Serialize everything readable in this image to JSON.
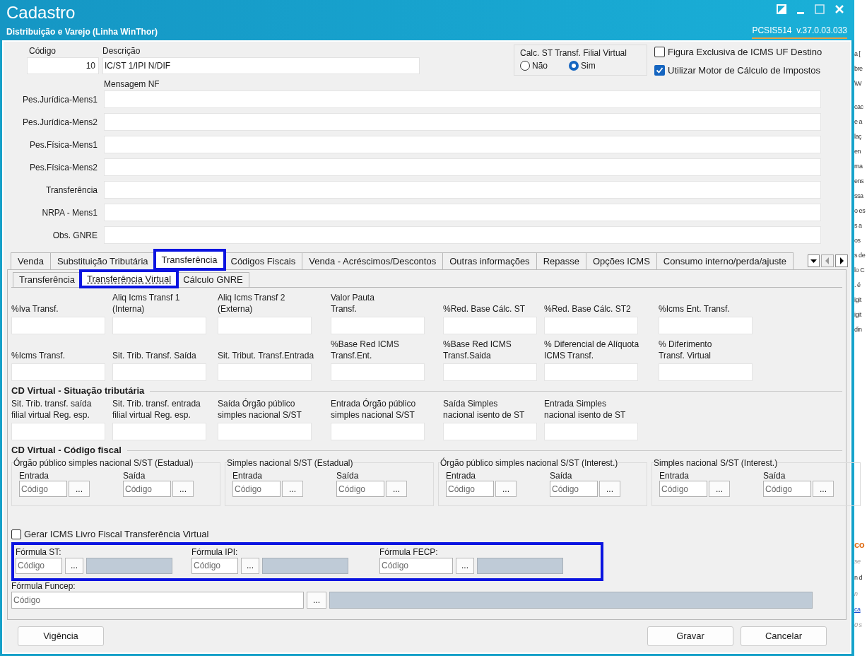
{
  "window": {
    "title": "Cadastro",
    "subtitle": "Distribuição e Varejo (Linha WinThor)",
    "version": "PCSIS514  v.37.0.03.033"
  },
  "header": {
    "codigo": {
      "label": "Código",
      "value": "10"
    },
    "descricao": {
      "label": "Descrição",
      "value": "IC/ST 1/IPI N/DIF"
    },
    "calc_st": {
      "label": "Calc. ST Transf. Filial Virtual",
      "options": [
        {
          "label": "Não",
          "selected": false
        },
        {
          "label": "Sim",
          "selected": true
        }
      ]
    },
    "checkboxes": [
      {
        "label": "Figura Exclusiva de ICMS UF Destino",
        "checked": false
      },
      {
        "label": "Utilizar Motor de Cálculo de Impostos",
        "checked": true
      }
    ]
  },
  "mensagem": {
    "title": "Mensagem NF",
    "fields": [
      {
        "label": "Pes.Jurídica-Mens1"
      },
      {
        "label": "Pes.Jurídica-Mens2"
      },
      {
        "label": "Pes.Física-Mens1"
      },
      {
        "label": "Pes.Física-Mens2"
      },
      {
        "label": "Transferência"
      },
      {
        "label": "NRPA - Mens1"
      },
      {
        "label": "Obs. GNRE"
      }
    ]
  },
  "tabs": [
    {
      "label": "Venda",
      "selected": false,
      "highlighted": false
    },
    {
      "label": "Substituição Tributária",
      "selected": false,
      "highlighted": false
    },
    {
      "label": "Transferência",
      "selected": true,
      "highlighted": true
    },
    {
      "label": "Códigos Fiscais",
      "selected": false,
      "highlighted": false
    },
    {
      "label": "Venda - Acréscimos/Descontos",
      "selected": false,
      "highlighted": false
    },
    {
      "label": "Outras informações",
      "selected": false,
      "highlighted": false
    },
    {
      "label": "Repasse",
      "selected": false,
      "highlighted": false
    },
    {
      "label": "Opções ICMS",
      "selected": false,
      "highlighted": false
    },
    {
      "label": "Consumo interno/perda/ajuste",
      "selected": false,
      "highlighted": false
    }
  ],
  "subtabs": [
    {
      "label": "Transferência",
      "selected": false,
      "highlighted": false
    },
    {
      "label": "Transferência Virtual",
      "selected": true,
      "highlighted": true
    },
    {
      "label": "Cálculo GNRE",
      "selected": false,
      "highlighted": false
    }
  ],
  "transfer_fields": [
    {
      "label": "%Iva Transf."
    },
    {
      "label": "Aliq Icms Transf 1\n(Interna)"
    },
    {
      "label": "Aliq Icms Transf 2\n(Externa)"
    },
    {
      "label": "Valor Pauta\nTransf."
    },
    {
      "label": "%Red. Base Cálc. ST"
    },
    {
      "label": "%Red. Base Cálc. ST2"
    },
    {
      "label": "%Icms Ent. Transf."
    },
    {
      "label": "%Icms Transf."
    },
    {
      "label": "Sit. Trib. Transf. Saída"
    },
    {
      "label": "Sit. Tribut. Transf.Entrada"
    },
    {
      "label": "%Base Red ICMS\nTransf.Ent."
    },
    {
      "label": "%Base Red ICMS\nTransf.Saida"
    },
    {
      "label": "% Diferencial de Alíquota\nICMS Transf."
    },
    {
      "label": "%  Diferimento\nTransf. Virtual"
    }
  ],
  "situacao": {
    "title": "CD Virtual - Situação tributária",
    "fields": [
      {
        "label": "Sit. Trib. transf. saída\nfilial virtual Reg. esp."
      },
      {
        "label": "Sit. Trib. transf. entrada\nfilial virtual Reg. esp."
      },
      {
        "label": "Saída Órgão público\nsimples nacional S/ST"
      },
      {
        "label": "Entrada Órgão público\nsimples nacional S/ST"
      },
      {
        "label": "Saída Simples\nnacional isento de ST"
      },
      {
        "label": "Entrada Simples\nnacional isento de ST"
      }
    ]
  },
  "codigo_fiscal": {
    "title": "CD Virtual - Código fiscal",
    "groups": [
      {
        "title": "Órgão público simples nacional S/ST (Estadual)",
        "fields": [
          {
            "label": "Entrada",
            "placeholder": "Código",
            "button": "..."
          },
          {
            "label": "Saída",
            "placeholder": "Código",
            "button": "..."
          }
        ]
      },
      {
        "title": "Simples nacional S/ST (Estadual)",
        "fields": [
          {
            "label": "Entrada",
            "placeholder": "Código",
            "button": "..."
          },
          {
            "label": "Saída",
            "placeholder": "Código",
            "button": "..."
          }
        ]
      },
      {
        "title": "Órgão público simples nacional S/ST (Interest.)",
        "fields": [
          {
            "label": "Entrada",
            "placeholder": "Código",
            "button": "..."
          },
          {
            "label": "Saída",
            "placeholder": "Código",
            "button": "..."
          }
        ]
      },
      {
        "title": "Simples nacional S/ST (Interest.)",
        "fields": [
          {
            "label": "Entrada",
            "placeholder": "Código",
            "button": "..."
          },
          {
            "label": "Saída",
            "placeholder": "Código",
            "button": "..."
          }
        ]
      }
    ]
  },
  "gerar": {
    "label": "Gerar ICMS Livro Fiscal Transferência Virtual",
    "checked": false
  },
  "formulas": {
    "highlighted": true,
    "items": [
      {
        "label": "Fórmula ST:",
        "placeholder": "Código",
        "button": "..."
      },
      {
        "label": "Fórmula IPI:",
        "placeholder": "Código",
        "button": "..."
      },
      {
        "label": "Fórmula FECP:",
        "placeholder": "Código",
        "button": "..."
      }
    ]
  },
  "funcep": {
    "label": "Fórmula Funcep:",
    "placeholder": "Código",
    "button": "..."
  },
  "buttons": {
    "left": [
      {
        "label": "Vigência"
      }
    ],
    "right": [
      {
        "label": "Gravar"
      },
      {
        "label": "Cancelar"
      }
    ]
  },
  "background_text": [
    {
      "text": "a [",
      "kind": "plain"
    },
    {
      "text": "bre",
      "kind": "plain"
    },
    {
      "text": "\\W",
      "kind": "plain"
    },
    {
      "text": "cac",
      "kind": "spaced"
    },
    {
      "text": "e a",
      "kind": "plain"
    },
    {
      "text": "laç",
      "kind": "plain"
    },
    {
      "text": "en",
      "kind": "plain"
    },
    {
      "text": "ma",
      "kind": "plain"
    },
    {
      "text": "ens",
      "kind": "plain"
    },
    {
      "text": "ssa",
      "kind": "plain"
    },
    {
      "text": "o es",
      "kind": "plain"
    },
    {
      "text": "s a",
      "kind": "plain"
    },
    {
      "text": "os",
      "kind": "plain"
    },
    {
      "text": "s de",
      "kind": "plain"
    },
    {
      "text": "lo C",
      "kind": "plain"
    },
    {
      "text": ". é",
      "kind": "plain"
    },
    {
      "text": "igit",
      "kind": "plain"
    },
    {
      "text": "igit",
      "kind": "plain"
    },
    {
      "text": "din",
      "kind": "plain"
    }
  ],
  "background_text_bottom": [
    {
      "text": "co",
      "kind": "heading"
    },
    {
      "text": "se",
      "kind": "muted"
    },
    {
      "text": "n d",
      "kind": "plain"
    },
    {
      "text": "n",
      "kind": "muted"
    },
    {
      "text": "ca",
      "kind": "link"
    },
    {
      "text": "0 s",
      "kind": "muted"
    }
  ]
}
